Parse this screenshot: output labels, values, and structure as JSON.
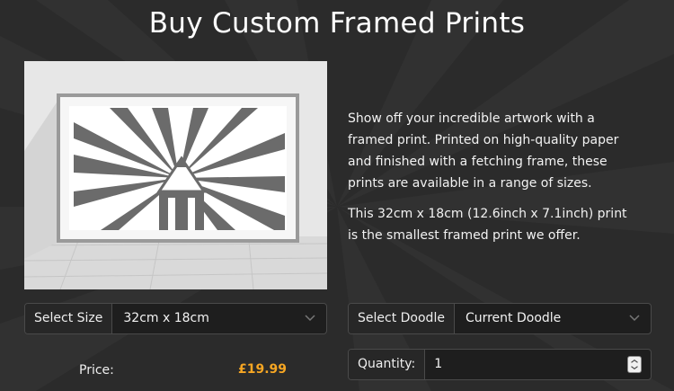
{
  "page": {
    "title": "Buy Custom Framed Prints"
  },
  "product": {
    "image_alt_icon": "framed-pencil-swirl-print",
    "description": [
      "Show off your incredible artwork with a framed print. Printed on high-quality paper and finished with a fetching frame, these prints are available in a range of sizes.",
      "This 32cm x 18cm (12.6inch x 7.1inch) print is the smallest framed print we offer."
    ]
  },
  "size_select": {
    "label": "Select Size",
    "value": "32cm x 18cm"
  },
  "doodle_select": {
    "label": "Select Doodle",
    "value": "Current Doodle"
  },
  "price": {
    "label": "Price:",
    "value": "£19.99"
  },
  "quantity": {
    "label": "Quantity:",
    "value": "1"
  },
  "colors": {
    "background": "#2b2b2b",
    "accent_price": "#f6a623",
    "print_gray": "#6b6b6b"
  }
}
